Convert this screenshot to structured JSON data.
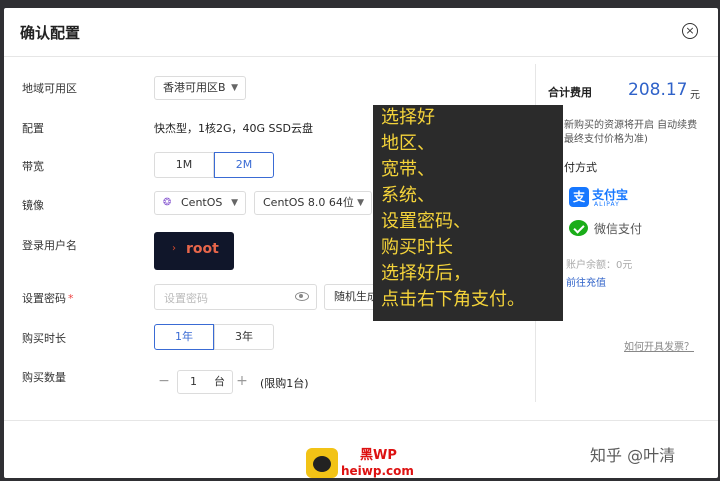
{
  "modal": {
    "title": "确认配置",
    "close_icon": "×"
  },
  "form": {
    "region": {
      "label": "地域可用区",
      "value": "香港可用区B"
    },
    "config": {
      "label": "配置",
      "value": "快杰型，1核2G，40G SSD云盘"
    },
    "bandwidth": {
      "label": "带宽",
      "options": [
        "1M",
        "2M"
      ],
      "selected": "2M"
    },
    "image": {
      "label": "镜像",
      "os": "CentOS",
      "version": "CentOS 8.0 64位"
    },
    "login_user": {
      "label": "登录用户名",
      "value": "root"
    },
    "password": {
      "label": "设置密码",
      "required_mark": "*",
      "placeholder": "设置密码",
      "generate_label": "随机生成"
    },
    "duration": {
      "label": "购买时长",
      "options": [
        "1年",
        "3年"
      ],
      "selected": "1年"
    },
    "quantity": {
      "label": "购买数量",
      "minus": "−",
      "value": "1",
      "unit": "台",
      "plus": "+",
      "limit": "(限购1台)"
    }
  },
  "summary": {
    "total_label": "合计费用",
    "total_value": "208.17",
    "total_unit": "元",
    "note_line1": "新购买的资源将开启 自动续费",
    "note_line2": "最终支付价格为准)",
    "pay_method_title": "付方式",
    "alipay_icon": "支",
    "alipay_label": "支付宝",
    "alipay_sub": "ALIPAY",
    "wechat_label": "微信支付",
    "balance": "账户余额：0元",
    "recharge": "前往充值",
    "invoice": "如何开具发票？"
  },
  "overlay_lines": [
    "选择好",
    "地区、",
    "宽带、",
    "系统、",
    "设置密码、",
    "购买时长",
    "选择好后，",
    "点击右下角支付。"
  ],
  "watermark": {
    "brand_top": "黑WP",
    "brand_bottom": "heiwp.com",
    "zhihu": "知乎 @叶清"
  },
  "colors": {
    "accent": "#3a6bd4",
    "price": "#2f62c9",
    "overlay_text": "#f4d33a"
  }
}
